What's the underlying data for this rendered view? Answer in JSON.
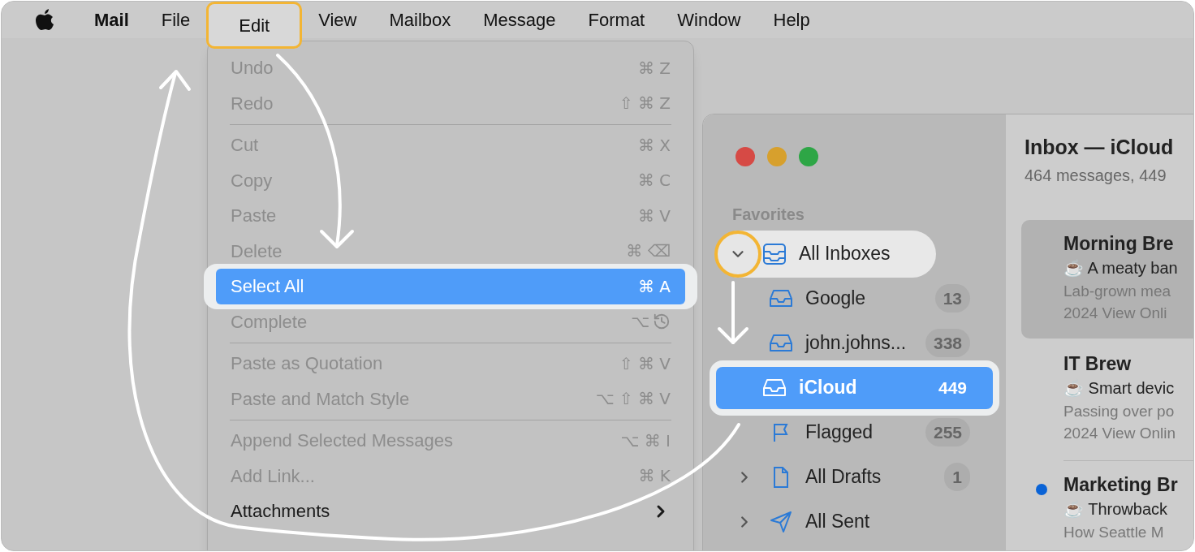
{
  "menu_bar": {
    "items": [
      {
        "label": "Mail",
        "kind": "app",
        "selected": false,
        "highlighted": false
      },
      {
        "label": "File",
        "kind": "menu",
        "selected": false,
        "highlighted": false
      },
      {
        "label": "Edit",
        "kind": "menu",
        "selected": true,
        "highlighted": true
      },
      {
        "label": "View",
        "kind": "menu",
        "selected": false,
        "highlighted": false
      },
      {
        "label": "Mailbox",
        "kind": "menu",
        "selected": false,
        "highlighted": false
      },
      {
        "label": "Message",
        "kind": "menu",
        "selected": false,
        "highlighted": false
      },
      {
        "label": "Format",
        "kind": "menu",
        "selected": false,
        "highlighted": false
      },
      {
        "label": "Window",
        "kind": "menu",
        "selected": false,
        "highlighted": false
      },
      {
        "label": "Help",
        "kind": "menu",
        "selected": false,
        "highlighted": false
      }
    ]
  },
  "edit_menu": {
    "sections": [
      {
        "items": [
          {
            "label": "Undo",
            "shortcut": "⌘ Z",
            "kind": "plain",
            "disabled": true,
            "selected": false,
            "highlighted": false
          },
          {
            "label": "Redo",
            "shortcut": "⇧ ⌘ Z",
            "kind": "plain",
            "disabled": true,
            "selected": false,
            "highlighted": false
          }
        ]
      },
      {
        "items": [
          {
            "label": "Cut",
            "shortcut": "⌘ X",
            "kind": "plain",
            "disabled": true,
            "selected": false,
            "highlighted": false
          },
          {
            "label": "Copy",
            "shortcut": "⌘ C",
            "kind": "plain",
            "disabled": true,
            "selected": false,
            "highlighted": false
          },
          {
            "label": "Paste",
            "shortcut": "⌘ V",
            "kind": "plain",
            "disabled": true,
            "selected": false,
            "highlighted": false
          },
          {
            "label": "Delete",
            "shortcut": "⌘ ⌫",
            "kind": "plain",
            "disabled": true,
            "selected": false,
            "highlighted": false
          },
          {
            "label": "Select All",
            "shortcut": "⌘ A",
            "kind": "plain",
            "disabled": false,
            "selected": true,
            "highlighted": true
          },
          {
            "label": "Complete",
            "shortcut": "⌥",
            "kind": "clock",
            "disabled": true,
            "selected": false,
            "highlighted": false
          }
        ]
      },
      {
        "items": [
          {
            "label": "Paste as Quotation",
            "shortcut": "⇧ ⌘ V",
            "kind": "plain",
            "disabled": true,
            "selected": false,
            "highlighted": false
          },
          {
            "label": "Paste and Match Style",
            "shortcut": "⌥ ⇧ ⌘ V",
            "kind": "plain",
            "disabled": true,
            "selected": false,
            "highlighted": false
          }
        ]
      },
      {
        "items": [
          {
            "label": "Append Selected Messages",
            "shortcut": "⌥ ⌘ I",
            "kind": "plain",
            "disabled": true,
            "selected": false,
            "highlighted": false
          },
          {
            "label": "Add Link...",
            "shortcut": "⌘ K",
            "kind": "plain",
            "disabled": true,
            "selected": false,
            "highlighted": false
          },
          {
            "label": "Attachments",
            "kind": "submenu",
            "disabled": false,
            "selected": false,
            "highlighted": false
          }
        ]
      }
    ]
  },
  "sidebar": {
    "section": "Favorites",
    "items": [
      {
        "label": "All Inboxes",
        "kind": "inboxes",
        "expanded": true,
        "selected": false,
        "highlighted": true,
        "children": [
          {
            "label": "Google",
            "count": "13",
            "kind": "inbox",
            "selected": false,
            "highlighted": false
          },
          {
            "label": "john.johns...",
            "count": "338",
            "kind": "inbox",
            "selected": false,
            "highlighted": false
          },
          {
            "label": "iCloud",
            "count": "449",
            "kind": "inbox",
            "selected": true,
            "highlighted": true
          }
        ]
      },
      {
        "label": "Flagged",
        "count": "255",
        "kind": "flag",
        "selected": false,
        "highlighted": false
      },
      {
        "label": "All Drafts",
        "count": "1",
        "kind": "drafts",
        "expanded": false,
        "selected": false,
        "highlighted": false
      },
      {
        "label": "All Sent",
        "kind": "sent",
        "expanded": false,
        "selected": false,
        "highlighted": false
      }
    ]
  },
  "message_list": {
    "title": "Inbox — iCloud",
    "subtitle": "464 messages, 449",
    "messages": [
      {
        "sender": "Morning Bre",
        "subject": "☕ A meaty ban",
        "preview_lines": [
          "Lab-grown mea",
          "2024 View Onli"
        ],
        "selected": true,
        "unread": false
      },
      {
        "sender": "IT Brew",
        "subject": "☕ Smart devic",
        "preview_lines": [
          "Passing over po",
          "2024 View Onlin"
        ],
        "selected": false,
        "unread": false
      },
      {
        "sender": "Marketing Br",
        "subject": "☕ Throwback",
        "preview_lines": [
          "How Seattle M"
        ],
        "selected": false,
        "unread": true
      }
    ]
  }
}
